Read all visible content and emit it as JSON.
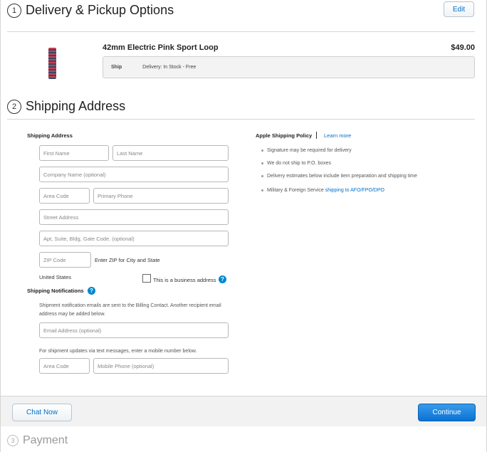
{
  "steps": {
    "delivery": {
      "number": "1",
      "title": "Delivery & Pickup Options",
      "edit_label": "Edit"
    },
    "shipping": {
      "number": "2",
      "title": "Shipping Address"
    },
    "payment": {
      "number": "3",
      "title": "Payment"
    }
  },
  "product": {
    "name": "42mm Electric Pink Sport Loop",
    "price": "$49.00",
    "ship_label": "Ship",
    "ship_value": "Delivery: In Stock - Free",
    "image_icon": "sport-loop-band-image",
    "band_colors": {
      "base": "#3d4660",
      "accent": "#c4425a"
    }
  },
  "address_form": {
    "section_label": "Shipping Address",
    "first_name_placeholder": "First Name",
    "last_name_placeholder": "Last Name",
    "company_placeholder": "Company Name (optional)",
    "area_code_placeholder": "Area Code",
    "primary_phone_placeholder": "Primary Phone",
    "street_placeholder": "Street Address",
    "apt_placeholder": "Apt, Suite, Bldg, Gate Code. (optional)",
    "zip_placeholder": "ZIP Code",
    "zip_hint": "Enter ZIP for City and State",
    "country": "United States",
    "business_label": "This is a business address"
  },
  "notifications": {
    "section_label": "Shipping Notifications",
    "email_note": "Shipment notification emails are sent to the Billing Contact. Another recipient email address may be added below.",
    "email_placeholder": "Email Address (optional)",
    "sms_note": "For shipment updates via text messages, enter a mobile number below.",
    "area_code_placeholder": "Area Code",
    "mobile_placeholder": "Mobile Phone (optional)"
  },
  "policy": {
    "title": "Apple Shipping Policy",
    "learn_more": "Learn more",
    "items": [
      "Signature may be required for delivery",
      "We do not ship to P.O. boxes",
      "Delivery estimates below include item preparation and shipping time",
      "Military & Foreign Service"
    ],
    "military_link": "shipping to AFO/FPO/DPO"
  },
  "actions": {
    "chat_label": "Chat Now",
    "continue_label": "Continue"
  },
  "colors": {
    "accent": "#0070c9",
    "primary_button": "#0a72d4"
  }
}
